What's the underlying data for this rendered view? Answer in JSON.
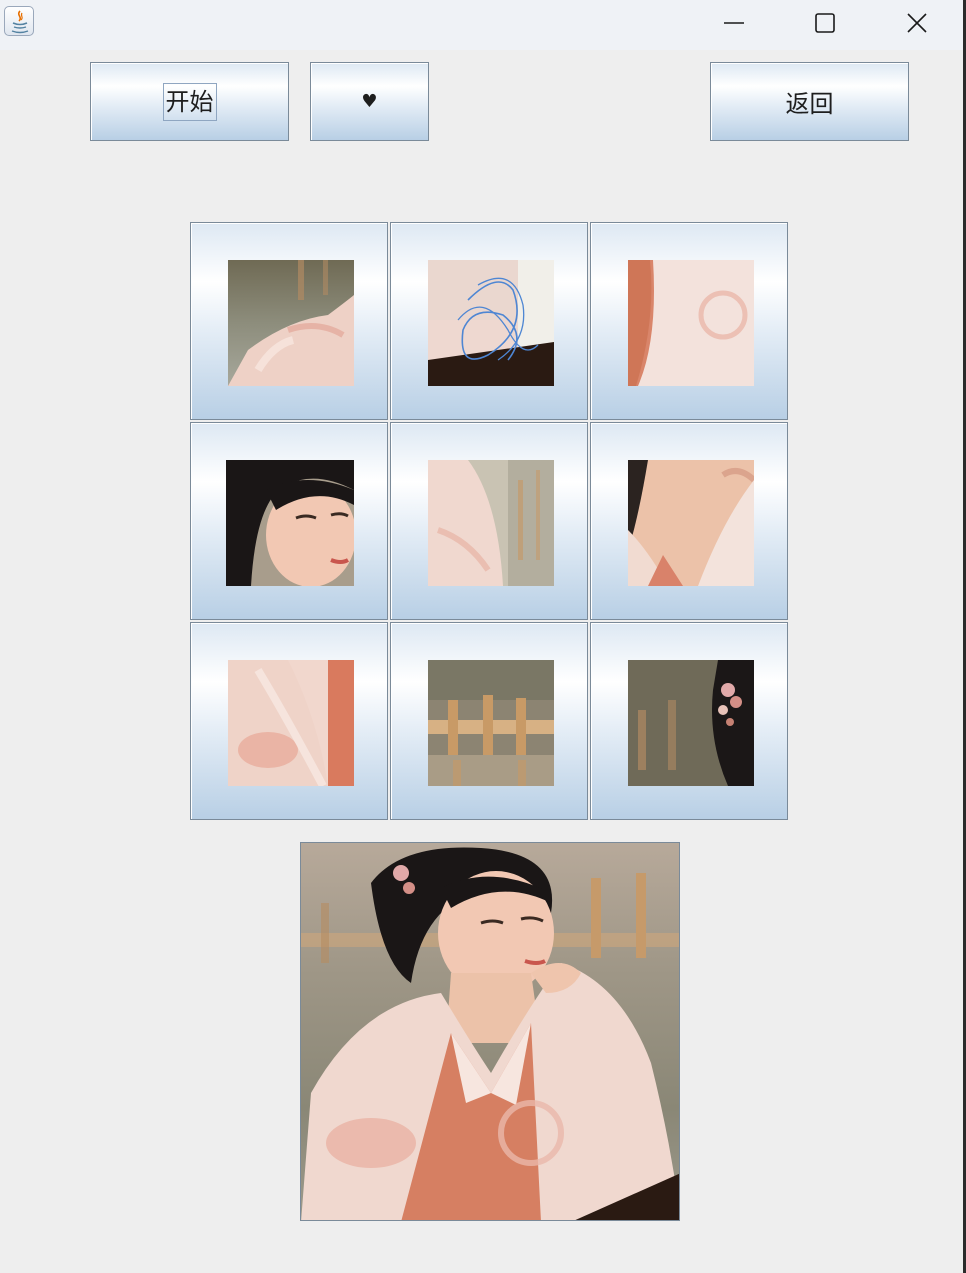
{
  "window": {
    "controls": {
      "minimize": "minimize-icon",
      "maximize": "maximize-icon",
      "close": "close-icon"
    },
    "app_icon": "java-icon"
  },
  "toolbar": {
    "start_label": "开始",
    "heart_label": "♥",
    "back_label": "返回"
  },
  "puzzle": {
    "rows": 3,
    "cols": 3,
    "tiles": [
      {
        "name": "tile-shoulder-water"
      },
      {
        "name": "tile-scribble-rail"
      },
      {
        "name": "tile-sleeve-right"
      },
      {
        "name": "tile-face"
      },
      {
        "name": "tile-sleeve-water"
      },
      {
        "name": "tile-neck"
      },
      {
        "name": "tile-robe-lower"
      },
      {
        "name": "tile-bridge"
      },
      {
        "name": "tile-hair-ornament"
      }
    ]
  },
  "preview": {
    "name": "original-image"
  },
  "colors": {
    "background": "#eeeeee",
    "titlebar": "#eff2f6",
    "button_border": "#7a8a99",
    "button_gradient_bottom": "#b8cfe5"
  }
}
